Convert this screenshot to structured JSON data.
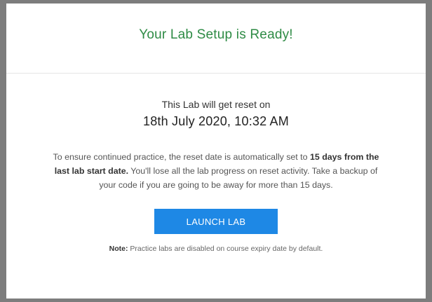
{
  "modal": {
    "title": "Your Lab Setup is Ready!",
    "reset_text": "This Lab will get reset on",
    "reset_date": "18th July 2020, 10:32 AM",
    "info_part1": "To ensure continued practice, the reset date is automatically set to ",
    "info_bold": "15 days from the last lab start date.",
    "info_part2": " You'll lose all the lab progress on reset activity. Take a backup of your code if you are going to be away for more than 15 days.",
    "launch_button_label": "LAUNCH LAB",
    "note_label": "Note:",
    "note_text": " Practice labs are disabled on course expiry date by default."
  },
  "colors": {
    "title_green": "#2e8b45",
    "button_blue": "#1e88e5"
  }
}
